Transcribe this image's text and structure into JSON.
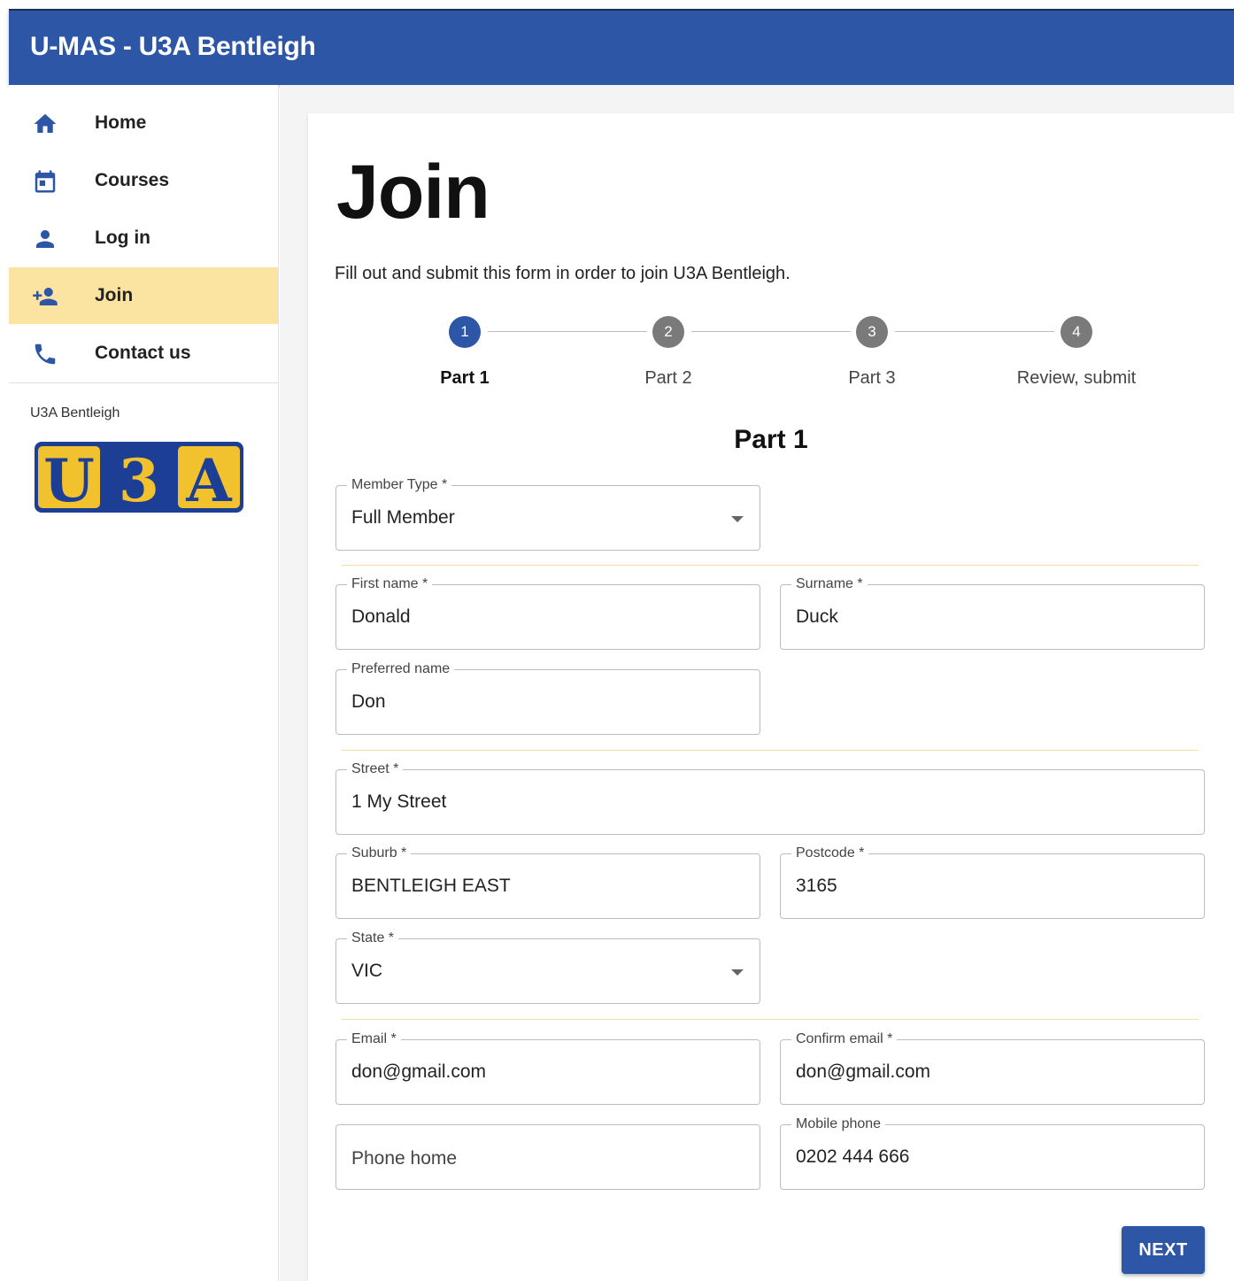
{
  "app": {
    "title": "U-MAS - U3A Bentleigh"
  },
  "sidebar": {
    "items": [
      {
        "label": "Home",
        "icon": "home-icon"
      },
      {
        "label": "Courses",
        "icon": "calendar-icon"
      },
      {
        "label": "Log in",
        "icon": "person-icon"
      },
      {
        "label": "Join",
        "icon": "person-add-icon",
        "active": true
      },
      {
        "label": "Contact us",
        "icon": "phone-icon"
      }
    ],
    "org_label": "U3A Bentleigh",
    "logo_letters": [
      "U",
      "3",
      "A"
    ]
  },
  "page": {
    "title": "Join",
    "intro": "Fill out and submit this form in order to join U3A Bentleigh."
  },
  "stepper": {
    "steps": [
      {
        "number": "1",
        "label": "Part 1",
        "active": true
      },
      {
        "number": "2",
        "label": "Part 2",
        "active": false
      },
      {
        "number": "3",
        "label": "Part 3",
        "active": false
      },
      {
        "number": "4",
        "label": "Review, submit",
        "active": false
      }
    ]
  },
  "form": {
    "section_title": "Part 1",
    "member_type": {
      "label": "Member Type *",
      "value": "Full Member"
    },
    "first_name": {
      "label": "First name *",
      "value": "Donald"
    },
    "surname": {
      "label": "Surname *",
      "value": "Duck"
    },
    "preferred_name": {
      "label": "Preferred name",
      "value": "Don"
    },
    "street": {
      "label": "Street *",
      "value": "1 My Street"
    },
    "suburb": {
      "label": "Suburb *",
      "value": "BENTLEIGH EAST"
    },
    "postcode": {
      "label": "Postcode *",
      "value": "3165"
    },
    "state": {
      "label": "State *",
      "value": "VIC"
    },
    "email": {
      "label": "Email *",
      "value": "don@gmail.com"
    },
    "confirm_email": {
      "label": "Confirm email *",
      "value": "don@gmail.com"
    },
    "phone_home": {
      "placeholder": "Phone home"
    },
    "mobile_phone": {
      "label": "Mobile phone",
      "value": "0202 444 666"
    },
    "next_label": "NEXT"
  },
  "colors": {
    "primary": "#2d56a6",
    "active_nav": "#fbe4a1",
    "logo_yellow": "#f2c12e",
    "logo_blue": "#1c3f95"
  }
}
